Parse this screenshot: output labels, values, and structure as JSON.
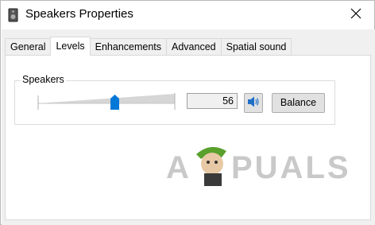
{
  "window": {
    "title": "Speakers Properties",
    "icon": "speaker-device-icon",
    "close_icon": "close-icon"
  },
  "tabs": [
    {
      "label": "General",
      "active": false
    },
    {
      "label": "Levels",
      "active": true
    },
    {
      "label": "Enhancements",
      "active": false
    },
    {
      "label": "Advanced",
      "active": false
    },
    {
      "label": "Spatial sound",
      "active": false
    }
  ],
  "levels": {
    "group_label": "Speakers",
    "volume_level": 56,
    "volume_value_text": "56",
    "mute_icon": "speaker-volume-icon",
    "balance_label": "Balance"
  },
  "watermark": {
    "text": "APPUALS"
  },
  "colors": {
    "accent": "#0078d7",
    "client_bg": "#f0f0f0",
    "button_bg": "#e1e1e1"
  }
}
